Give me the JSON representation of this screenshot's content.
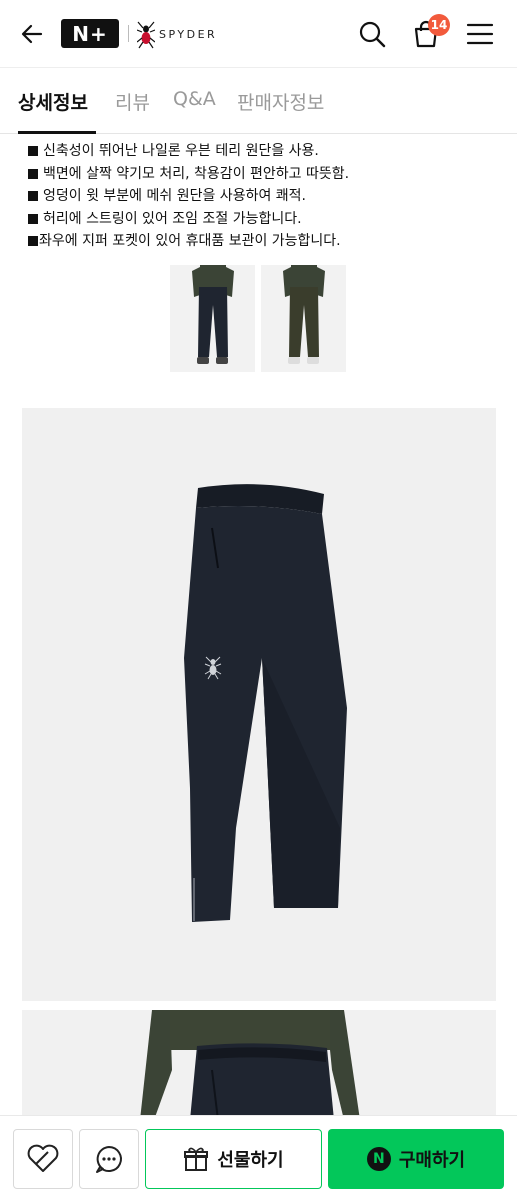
{
  "header": {
    "logo_text": "N+",
    "brand": "SPYDER",
    "cart_count": "14"
  },
  "tabs": [
    {
      "label": "상세정보",
      "active": true
    },
    {
      "label": "리뷰",
      "active": false
    },
    {
      "label": "Q&A",
      "active": false
    },
    {
      "label": "판매자정보",
      "active": false
    }
  ],
  "description": [
    "신축성이 뛰어난 나일론 우븐 테리 원단을 사용.",
    "백면에 살짝 약기모 처리, 착용감이 편안하고 따뜻함.",
    "엉덩이 윗 부분에 메쉬 원단을 사용하여 쾌적.",
    "허리에 스트링이 있어 조임 조절 가능합니다.",
    "좌우에 지퍼 포켓이 있어 휴대품 보관이 가능합니다."
  ],
  "bottom_bar": {
    "gift_label": "선물하기",
    "buy_label": "구매하기",
    "npay_mark": "N"
  },
  "colors": {
    "accent_green": "#03c75a",
    "badge_red": "#f25a3c",
    "pants_navy": "#1f2530",
    "pants_olive": "#3a3d2c"
  }
}
